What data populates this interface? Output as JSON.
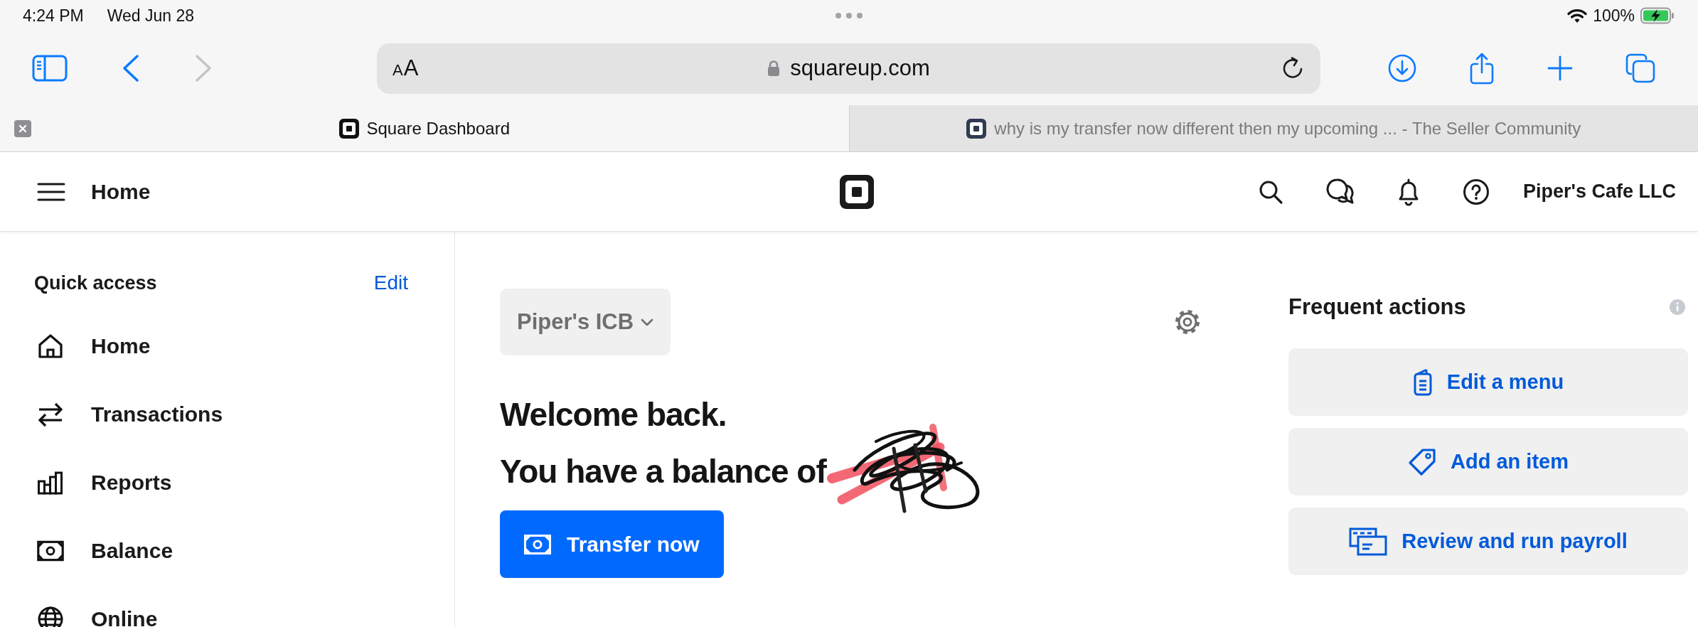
{
  "status_bar": {
    "time": "4:24 PM",
    "date": "Wed Jun 28",
    "battery": "100%"
  },
  "toolbar": {
    "navigation": [
      {
        "kind": "back",
        "disabled": false
      },
      {
        "kind": "forward",
        "disabled": true
      }
    ],
    "reader_button": "AA",
    "url": "squareup.com"
  },
  "tabs": [
    {
      "title": "Square Dashboard",
      "selected": true
    },
    {
      "title": "why is my transfer now different then my upcoming ... - The Seller Community",
      "selected": false
    }
  ],
  "header": {
    "page_title": "Home",
    "business_name": "Piper's Cafe LLC"
  },
  "sidebar": {
    "heading": "Quick access",
    "edit_link": "Edit",
    "items": [
      {
        "label": "Home",
        "kind": "home"
      },
      {
        "label": "Transactions",
        "kind": "transactions"
      },
      {
        "label": "Reports",
        "kind": "reports"
      },
      {
        "label": "Balance",
        "kind": "balance"
      },
      {
        "label": "Online",
        "kind": "online"
      }
    ]
  },
  "main": {
    "location_selector": "Piper's ICB",
    "greeting": "Welcome back.",
    "balance_text": "You have a balance of",
    "transfer_button": "Transfer now"
  },
  "frequent_actions": {
    "title": "Frequent actions",
    "actions": [
      {
        "label": "Edit a menu",
        "kind": "menu"
      },
      {
        "label": "Add an item",
        "kind": "item"
      },
      {
        "label": "Review and run payroll",
        "kind": "payroll"
      }
    ]
  }
}
